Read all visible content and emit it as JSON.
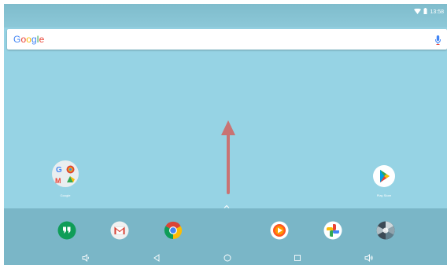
{
  "status": {
    "time": "13:58",
    "icons": [
      "wifi-icon",
      "battery-icon"
    ]
  },
  "search": {
    "logo": {
      "letters": [
        "G",
        "o",
        "o",
        "g",
        "l",
        "e"
      ],
      "colors": [
        "#4285f4",
        "#ea4335",
        "#fbbc05",
        "#4285f4",
        "#34a853",
        "#ea4335"
      ]
    },
    "mic_icon": "mic-icon"
  },
  "home": {
    "folder": {
      "label": "Google",
      "icon": "google-folder-icon"
    },
    "play_store": {
      "label": "Play Store",
      "icon": "play-store-icon"
    },
    "swipe_hint_icon": "swipe-up-arrow-icon",
    "app_drawer_icon": "chevron-up-icon"
  },
  "dock": {
    "apps": [
      {
        "name": "Hangouts",
        "icon": "hangouts-icon"
      },
      {
        "name": "Gmail",
        "icon": "gmail-icon"
      },
      {
        "name": "Chrome",
        "icon": "chrome-icon"
      },
      {
        "name": "Play Music",
        "icon": "play-music-icon"
      },
      {
        "name": "Photos",
        "icon": "photos-icon"
      },
      {
        "name": "Camera",
        "icon": "camera-icon"
      }
    ]
  },
  "navbar": {
    "buttons": [
      "volume-down-icon",
      "back-icon",
      "home-icon",
      "recents-icon",
      "volume-up-icon"
    ]
  },
  "colors": {
    "wallpaper": "#96d3e4",
    "arrow": "#c97373",
    "dock": "#7ab6c7"
  }
}
